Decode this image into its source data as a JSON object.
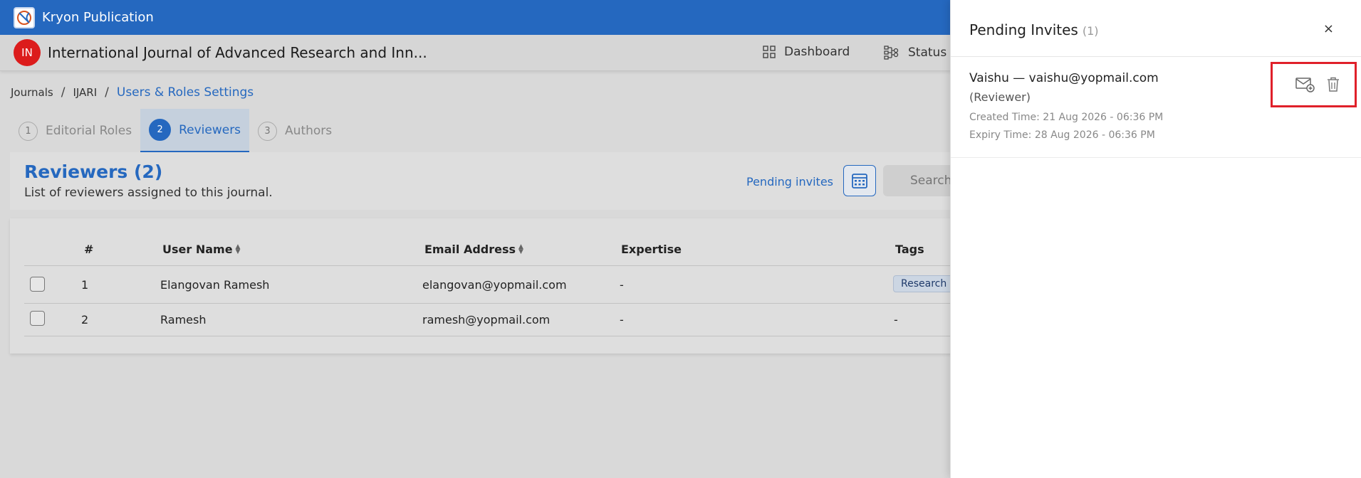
{
  "app": {
    "name": "Kryon Publication"
  },
  "journal": {
    "avatar_initials": "IN",
    "title": "International Journal of Advanced Research and Inn...",
    "nav": {
      "dashboard": "Dashboard",
      "status": "Status B"
    }
  },
  "breadcrumb": {
    "journals": "Journals",
    "code": "IJARI",
    "current": "Users & Roles Settings"
  },
  "tabs": [
    {
      "num": "1",
      "label": "Editorial Roles"
    },
    {
      "num": "2",
      "label": "Reviewers"
    },
    {
      "num": "3",
      "label": "Authors"
    }
  ],
  "reviewers": {
    "title": "Reviewers (2)",
    "subtitle": "List of reviewers assigned to this journal.",
    "pending_link": "Pending invites",
    "search_placeholder": "Search"
  },
  "table": {
    "headers": {
      "num": "#",
      "username": "User Name",
      "email": "Email Address",
      "expertise": "Expertise",
      "tags": "Tags"
    },
    "rows": [
      {
        "num": "1",
        "username": "Elangovan Ramesh",
        "email": "elangovan@yopmail.com",
        "expertise": "-",
        "tag": "Research"
      },
      {
        "num": "2",
        "username": "Ramesh",
        "email": "ramesh@yopmail.com",
        "expertise": "-",
        "tag": "-"
      }
    ]
  },
  "panel": {
    "title": "Pending Invites",
    "count": "(1)",
    "close": "×",
    "invite": {
      "name": "Vaishu — vaishu@yopmail.com",
      "role": "(Reviewer)",
      "created": "Created Time: 21 Aug 2026 - 06:36 PM",
      "expiry": "Expiry Time: 28 Aug 2026 - 06:36 PM"
    }
  },
  "icons": {
    "logo": "kryon-logo-icon",
    "dashboard": "grid-icon",
    "status": "workflow-icon",
    "calendar": "calendar-icon",
    "resend": "resend-mail-icon",
    "delete": "trash-icon"
  },
  "colors": {
    "primary": "#2568bf",
    "avatar": "#dc1c1c",
    "highlight": "#e0202a"
  }
}
